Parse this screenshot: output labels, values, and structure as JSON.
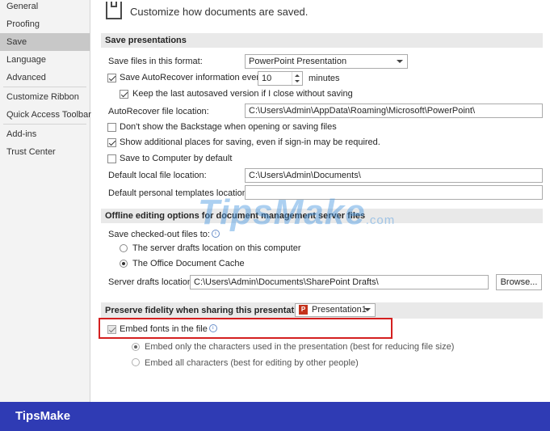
{
  "sidebar": {
    "items": [
      "General",
      "Proofing",
      "Save",
      "Language",
      "Advanced",
      "Customize Ribbon",
      "Quick Access Toolbar",
      "Add-ins",
      "Trust Center"
    ],
    "selected": "Save"
  },
  "header": {
    "title": "Customize how documents are saved."
  },
  "save_presentations": {
    "heading": "Save presentations",
    "format_label": "Save files in this format:",
    "format_value": "PowerPoint Presentation",
    "autorecover_label": "Save AutoRecover information every",
    "autorecover_value": "10",
    "minutes_label": "minutes",
    "keep_last_label": "Keep the last autosaved version if I close without saving",
    "autorecover_location_label": "AutoRecover file location:",
    "autorecover_location_value": "C:\\Users\\Admin\\AppData\\Roaming\\Microsoft\\PowerPoint\\",
    "dont_show_backstage_label": "Don't show the Backstage when opening or saving files",
    "show_additional_label": "Show additional places for saving, even if sign-in may be required.",
    "save_to_computer_label": "Save to Computer by default",
    "default_local_label": "Default local file location:",
    "default_local_value": "C:\\Users\\Admin\\Documents\\",
    "default_templates_label": "Default personal templates location:",
    "default_templates_value": ""
  },
  "offline": {
    "heading": "Offline editing options for document management server files",
    "save_checked_out_label": "Save checked-out files to:",
    "option_server": "The server drafts location on this computer",
    "option_cache": "The Office Document Cache",
    "server_drafts_label": "Server drafts location:",
    "server_drafts_value": "C:\\Users\\Admin\\Documents\\SharePoint Drafts\\",
    "browse_label": "Browse..."
  },
  "fidelity": {
    "heading": "Preserve fidelity when sharing this presentation:",
    "presentation_value": "Presentation1",
    "embed_fonts_label": "Embed fonts in the file",
    "embed_only_label": "Embed only the characters used in the presentation (best for reducing file size)",
    "embed_all_label": "Embed all characters (best for editing by other people)"
  },
  "watermark": {
    "text": "TipsMake",
    "suffix": ".com"
  },
  "footer": {
    "brand": "TipsMake"
  },
  "colors": {
    "footer_bg": "#2f3bb4",
    "highlight_border": "#d42020",
    "section_bg": "#e9e9e9",
    "nav_selected_bg": "#c8c8c8"
  },
  "state": {
    "autorecover_checked": true,
    "keep_last_checked": true,
    "dont_show_backstage_checked": false,
    "show_additional_checked": true,
    "save_to_computer_checked": false,
    "selected_offline_option": "cache",
    "embed_fonts_checked": true,
    "embed_fonts_disabled": true,
    "selected_embed_option": "only"
  }
}
